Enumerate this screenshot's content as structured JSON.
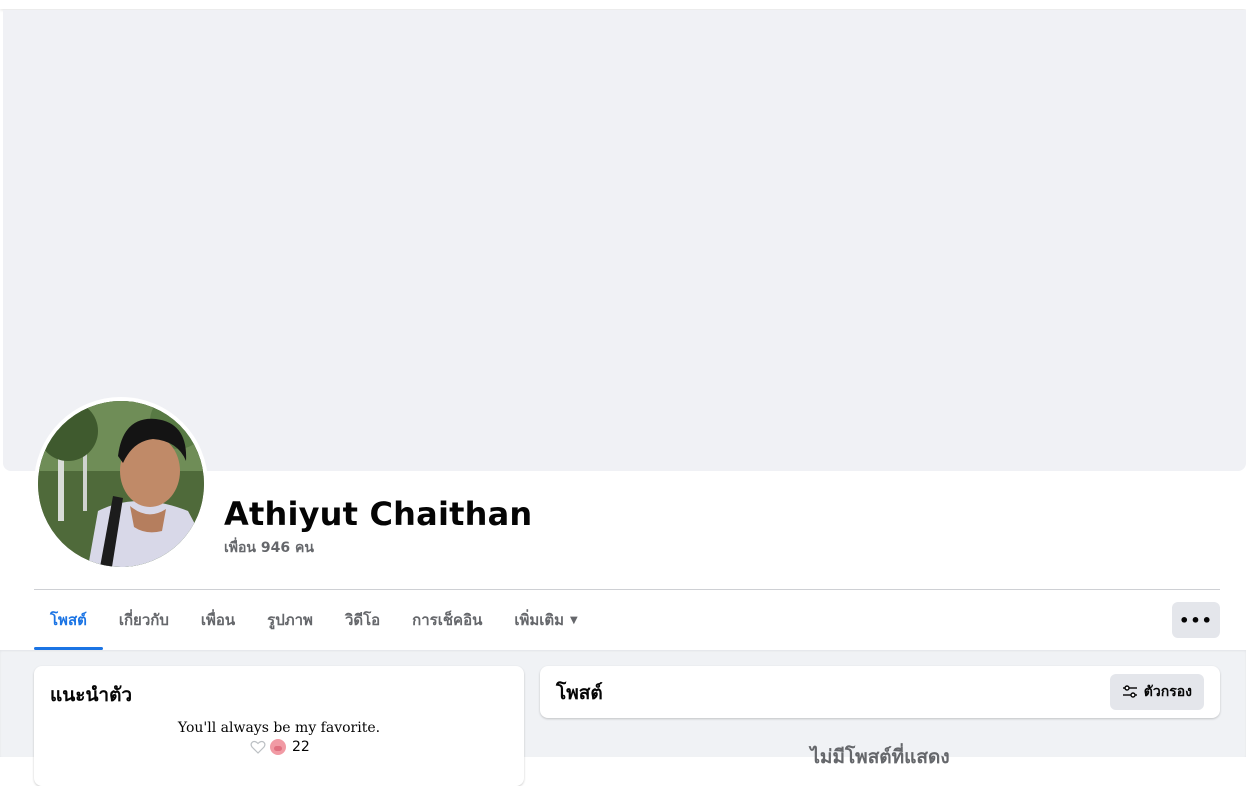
{
  "profile": {
    "name": "Athiyut Chaithan",
    "friends": "เพื่อน 946 คน"
  },
  "tabs": [
    {
      "label": "โพสต์",
      "active": true
    },
    {
      "label": "เกี่ยวกับ"
    },
    {
      "label": "เพื่อน"
    },
    {
      "label": "รูปภาพ"
    },
    {
      "label": "วิดีโอ"
    },
    {
      "label": "การเช็คอิน"
    },
    {
      "label": "เพิ่มเติม"
    }
  ],
  "more_button": {
    "icon": "ellipsis-icon",
    "label": "•••"
  },
  "intro": {
    "title": "แนะนำตัว",
    "bio": "You'll always be my favorite.",
    "reaction_count": "22"
  },
  "posts": {
    "title": "โพสต์",
    "filter_label": "ตัวกรอง",
    "empty_text": "ไม่มีโพสต์ที่แสดง"
  },
  "colors": {
    "accent": "#1b74e4",
    "cover": "#f0f1f5",
    "page_bg": "#f0f2f5"
  }
}
